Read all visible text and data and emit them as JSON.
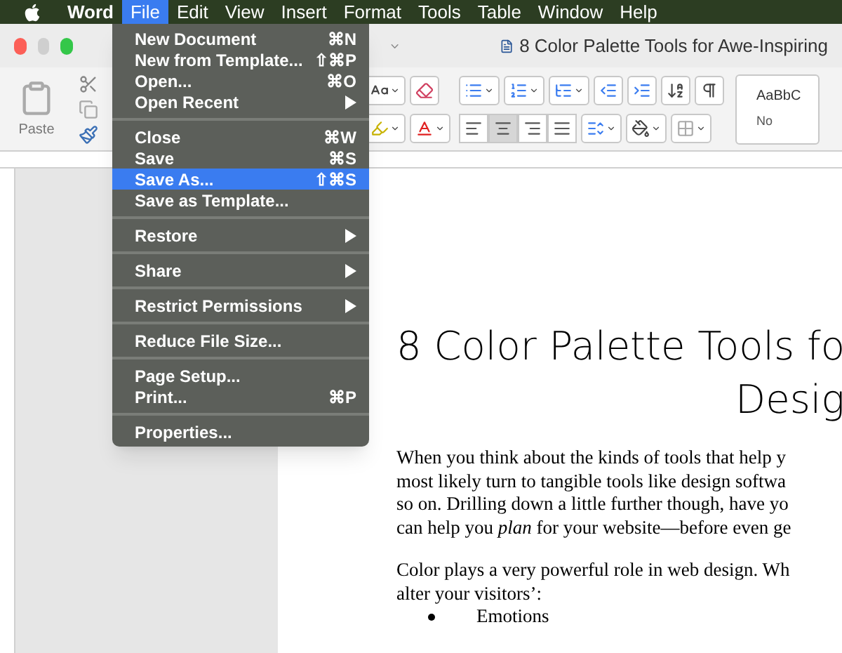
{
  "menu_bar": [
    {
      "label": "Word",
      "selected": false,
      "bold": true
    },
    {
      "label": "File",
      "selected": true,
      "bold": false
    },
    {
      "label": "Edit",
      "selected": false,
      "bold": false
    },
    {
      "label": "View",
      "selected": false,
      "bold": false
    },
    {
      "label": "Insert",
      "selected": false,
      "bold": false
    },
    {
      "label": "Format",
      "selected": false,
      "bold": false
    },
    {
      "label": "Tools",
      "selected": false,
      "bold": false
    },
    {
      "label": "Table",
      "selected": false,
      "bold": false
    },
    {
      "label": "Window",
      "selected": false,
      "bold": false
    },
    {
      "label": "Help",
      "selected": false,
      "bold": false
    }
  ],
  "file_menu": [
    [
      {
        "label": "New Document",
        "shortcut": "⌘N",
        "submenu": false,
        "selected": false
      },
      {
        "label": "New from Template...",
        "shortcut": "⇧⌘P",
        "submenu": false,
        "selected": false
      },
      {
        "label": "Open...",
        "shortcut": "⌘O",
        "submenu": false,
        "selected": false
      },
      {
        "label": "Open Recent",
        "submenu": true,
        "selected": false
      }
    ],
    [
      {
        "label": "Close",
        "shortcut": "⌘W",
        "submenu": false,
        "selected": false
      },
      {
        "label": "Save",
        "shortcut": "⌘S",
        "submenu": false,
        "selected": false
      },
      {
        "label": "Save As...",
        "shortcut": "⇧⌘S",
        "submenu": false,
        "selected": true
      },
      {
        "label": "Save as Template...",
        "submenu": false,
        "selected": false
      }
    ],
    [
      {
        "label": "Restore",
        "submenu": true,
        "selected": false
      }
    ],
    [
      {
        "label": "Share",
        "submenu": true,
        "selected": false
      }
    ],
    [
      {
        "label": "Restrict Permissions",
        "submenu": true,
        "selected": false
      }
    ],
    [
      {
        "label": "Reduce File Size...",
        "submenu": false,
        "selected": false
      }
    ],
    [
      {
        "label": "Page Setup...",
        "submenu": false,
        "selected": false
      },
      {
        "label": "Print...",
        "shortcut": "⌘P",
        "submenu": false,
        "selected": false
      }
    ],
    [
      {
        "label": "Properties...",
        "submenu": false,
        "selected": false
      }
    ]
  ],
  "window": {
    "title": "8 Color Palette Tools for Awe-Inspiring"
  },
  "toolbar": {
    "paste_label": "Paste",
    "align_buttons": [
      {
        "kind": "left",
        "selected": false
      },
      {
        "kind": "center",
        "selected": true
      },
      {
        "kind": "right",
        "selected": false
      },
      {
        "kind": "justify",
        "selected": false
      }
    ],
    "style_preview": "AaBbC",
    "style_name": "No"
  },
  "document": {
    "title_lines": [
      "8 Color Palette Tools fo",
      "Desig"
    ],
    "paragraphs": [
      [
        "When you think about the kinds of tools that help y",
        "most likely turn to tangible tools like design softwa",
        "so on. Drilling down a little further though, have yo",
        "can help you *plan* for your website—before even ge"
      ],
      [
        "Color plays a very powerful role in web design. Wh",
        "alter your visitors’:"
      ]
    ],
    "bullets": [
      "Emotions"
    ]
  }
}
